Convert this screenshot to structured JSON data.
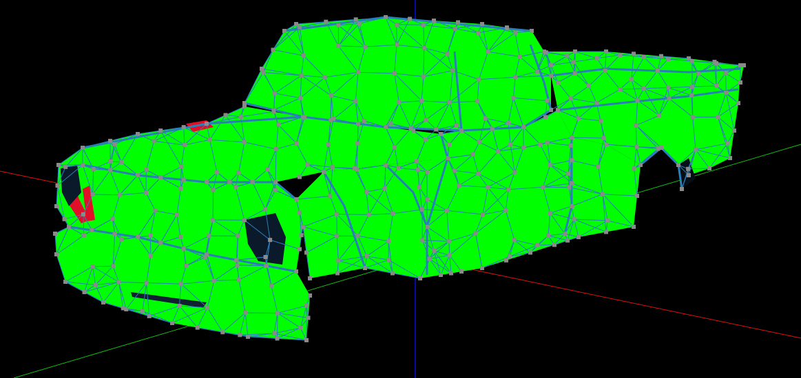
{
  "viewport": {
    "background": "#000000",
    "render_mode": "wireframe-over-solid",
    "model": "pickup-truck-body"
  },
  "axes": {
    "x_color": "#e01010",
    "y_color": "#0a0ad8",
    "z_color": "#10c010"
  },
  "mesh": {
    "fill_color": "#00ff00",
    "edge_color": "#2a7fb8",
    "vertex_color": "#8a8a8a",
    "highlight_color": "#e0102a"
  }
}
